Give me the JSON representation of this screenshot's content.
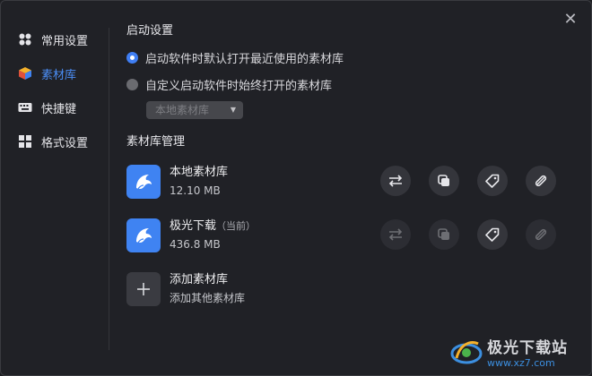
{
  "window": {
    "close_label": "✕"
  },
  "sidebar": {
    "items": [
      {
        "label": "常用设置",
        "icon": "grid-dots-icon",
        "active": false
      },
      {
        "label": "素材库",
        "icon": "cube-icon",
        "active": true
      },
      {
        "label": "快捷键",
        "icon": "keyboard-icon",
        "active": false
      },
      {
        "label": "格式设置",
        "icon": "tiles-icon",
        "active": false
      }
    ]
  },
  "startup": {
    "title": "启动设置",
    "option1": "启动软件时默认打开最近使用的素材库",
    "option2": "自定义启动软件时始终打开的素材库",
    "select_value": "本地素材库"
  },
  "library": {
    "title": "素材库管理",
    "items": [
      {
        "name": "本地素材库",
        "tag": "",
        "size": "12.10 MB"
      },
      {
        "name": "极光下载",
        "tag": "（当前）",
        "size": "436.8 MB"
      }
    ],
    "add": {
      "name": "添加素材库",
      "sub": "添加其他素材库"
    }
  },
  "watermark": {
    "title": "极光下载站",
    "url": "www.xz7.com"
  },
  "colors": {
    "accent": "#3f7ef3",
    "background": "#202126",
    "icon_bg": "#3f83f2"
  }
}
